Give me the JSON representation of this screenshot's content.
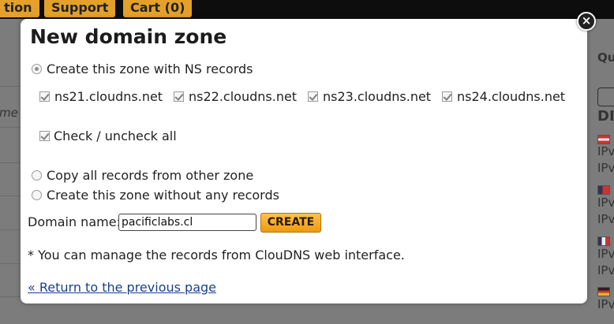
{
  "background": {
    "nav": [
      "tion",
      "Support",
      "Cart (0)"
    ],
    "left_fragment": "me",
    "right_fragments": [
      "Qu",
      "DI",
      "IPv",
      "IPv",
      "IPv",
      "IPv",
      "IPv",
      "IPv",
      "IPv",
      "IPv",
      "IPv"
    ]
  },
  "modal": {
    "title": "New domain zone",
    "close_label": "×",
    "radio_ns": "Create this zone with NS records",
    "nameservers": [
      "ns21.cloudns.net",
      "ns22.cloudns.net",
      "ns23.cloudns.net",
      "ns24.cloudns.net"
    ],
    "check_all": "Check / uncheck all",
    "radio_copy": "Copy all records from other zone",
    "radio_empty": "Create this zone without any records",
    "domain_label": "Domain name:",
    "domain_value": "pacificlabs.cl",
    "create_button": "CREATE",
    "note": "* You can manage the records from ClouDNS web interface.",
    "return_link": "« Return to the previous page"
  },
  "colors": {
    "accent": "#e3a12a",
    "button": "#f5a623",
    "link": "#1a3f8f",
    "overlay": "#7c7c7c"
  }
}
